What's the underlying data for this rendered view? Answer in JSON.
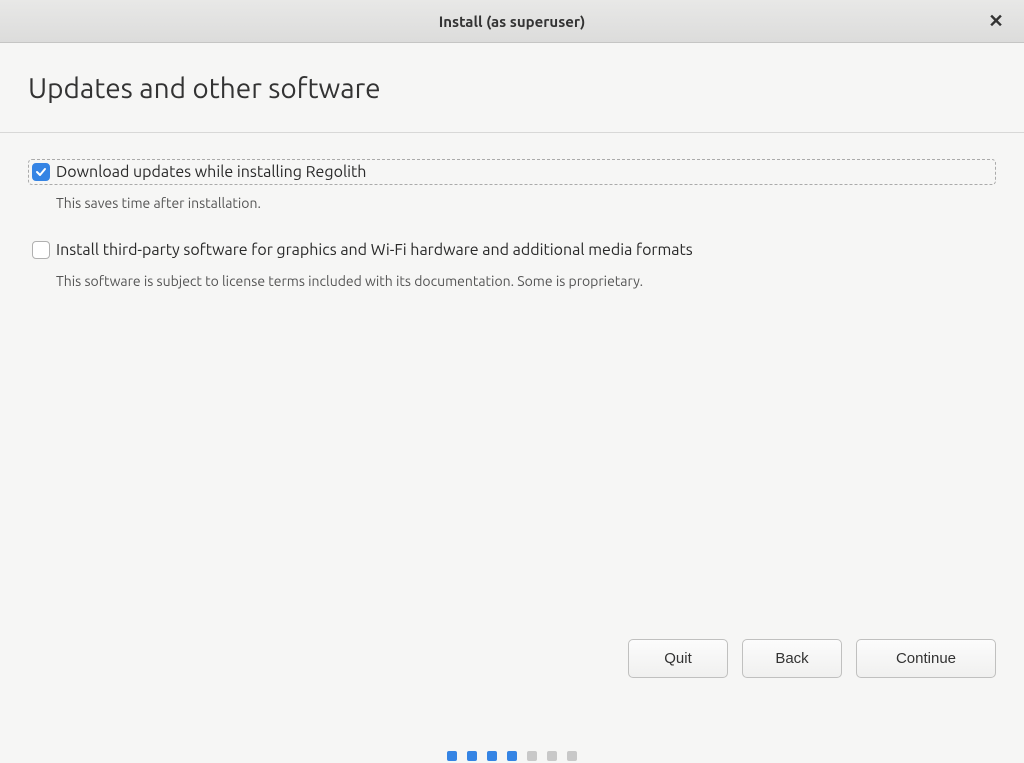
{
  "titlebar": {
    "title": "Install (as superuser)"
  },
  "header": {
    "page_title": "Updates and other software"
  },
  "options": {
    "download_updates": {
      "label": "Download updates while installing Regolith",
      "description": "This saves time after installation.",
      "checked": true
    },
    "third_party": {
      "label": "Install third-party software for graphics and Wi-Fi hardware and additional media formats",
      "description": "This software is subject to license terms included with its documentation. Some is proprietary.",
      "checked": false
    }
  },
  "buttons": {
    "quit": "Quit",
    "back": "Back",
    "continue": "Continue"
  },
  "progress": {
    "total": 7,
    "active": [
      0,
      1,
      2,
      3
    ]
  }
}
